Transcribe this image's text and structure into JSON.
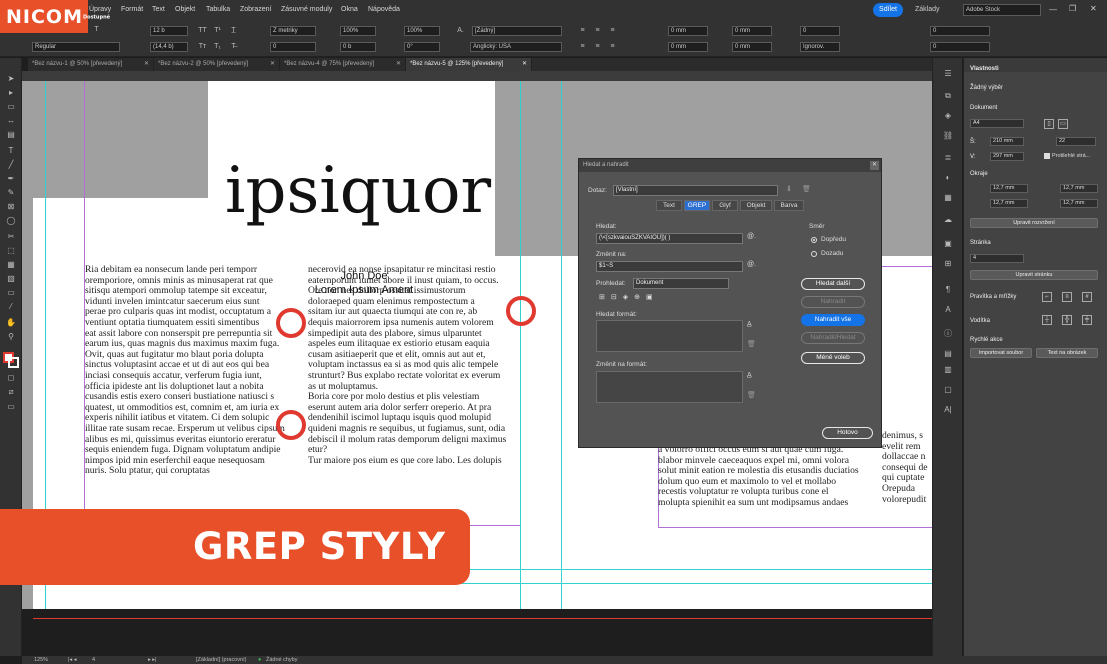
{
  "branding": {
    "logo": "NICOM",
    "logo_sub": "Dostupné",
    "badge": "GREP STYLY"
  },
  "menu": [
    "Úpravy",
    "Formát",
    "Text",
    "Objekt",
    "Tabulka",
    "Zobrazení",
    "Zásuvné moduly",
    "Okna",
    "Nápověda"
  ],
  "topbar": {
    "share": "Sdílet",
    "workspace": "Základy",
    "search_placeholder": "Adobe Stock"
  },
  "control": {
    "font_size": "12 b",
    "leading": "(14,4 b)",
    "font_style": "Regular",
    "tracking": "Z metriky",
    "kerning": "0",
    "hscale": "100%",
    "vscale": "100%",
    "baseline": "0 b",
    "skew": "0°",
    "char_style": "[Žádný]",
    "language": "Anglický: USA",
    "indent_left": "0 mm",
    "indent_right": "0 mm",
    "space_before": "0 mm",
    "space_after": "0 mm",
    "drop": "0",
    "hyphen": "Ignorov.",
    "cols": "0",
    "gutter": "0"
  },
  "tabs": [
    {
      "label": "*Bez názvu-1 @ 50% [převedený]",
      "close": "✕"
    },
    {
      "label": "*Bez názvu-2 @ 50% [převedený]",
      "close": "✕"
    },
    {
      "label": "*Bez názvu-4 @ 75% [převedený]",
      "close": "✕"
    },
    {
      "label": "*Bez názvu-5 @ 125% [převedený]",
      "close": "✕"
    }
  ],
  "document": {
    "big_word": "ipsiquor",
    "author": "John Doe",
    "subtitle": "Lorem Ipsum Ament",
    "page_number": "4",
    "col1": [
      "Ria debitam ea nonsecum lande peri temporr",
      "oremporiore, omnis minis as minusaperat rat que",
      "sitisqu atempori ommolup tatempe sit exceatur,",
      "vidunti invelen imintcatur saecerum eius sunt",
      "perae pro culparis quas int modist, occuptatum a",
      "ventiunt optatia tiumquatem essiti simentibus",
      "eat assit labore con nonserspit pre perrepuntia sit",
      "earum ius, quas magnis dus maximus maxim fuga.",
      "Ovit, quas aut fugitatur mo blaut poria dolupta",
      "sinctus voluptasint accae et ut di aut eos qui bea",
      "inciasi consequis accatur, verferum fugia iunt,",
      "officia ipideste ant lis doluptionet laut a nobita",
      "cusandis estis exero conseri bustiatione natiusci s",
      "quatest, ut ommoditios est, comnim et, am iuria ex",
      "experis nihilit iatibus et vitatem. Ci dem solupic",
      "illitae rate susam recae. Ersperum ut velibus cipsum",
      "alibus es mi, quissimus everitas eiuntorio ereratur",
      "sequis eniendem fuga. Dignam voluptatum andipie",
      "nimpos ipid min eserferchil eaque nesequosam",
      "nuris. Solu ptatur, qui coruptatas"
    ],
    "col2": [
      "necerovid ea nonse ipsapitatur re mincitasi restio",
      "eaternporunt iumet abore il inust quiam, to occus.",
      "Ore non nes dollorp ossitat issimustorum",
      "doloraeped quam elenimus rempostectum a",
      "ssitam iur aut quaecta tiumqui ate con re, ab",
      "dequis maiorrorem ipsa numenis autem volorem",
      "simpedipit auta des plabore, simus ulparuntet",
      "aspeles eum ilitaquae ex estiorio etusam eaquia",
      "cusam asitiaeperit que et elit, omnis aut aut et,",
      "voluptam inctassus ea si as mod quis alic tempele",
      "strunturt? Bus explabo rectate voloritat ex everum",
      "as ut moluptamus.",
      "Boria core por molo destius et plis velestiam",
      "eserunt autem aria dolor serferr oreperio. At pra",
      "dendenihil iscimol luptaqu isquis quod molupid",
      "quideni magnis re sequibus, ut fugiamus, sunt, odia",
      "debiscil il molum ratas demporum deligni maximus",
      "etur?",
      "Tur maiore pos eium es que core labo. Les dolupis"
    ],
    "col3": [
      "a volorro offici occus eum si aut quae cum fuga.",
      "blabor minvele caeceaquos expel mi, omni volora",
      "solut minit eation re molestia dis etusandis duciatios",
      "dolum quo eum et maximolo to vel et mollabo",
      "recestis voluptatur re volupta turibus cone el",
      "molupta spienihit ea sum unt modipsamus andaes"
    ],
    "col4": [
      "denimus, s",
      "evelit rem",
      "dollaccae n",
      "consequi de",
      "qui cuptate",
      "Orepuda",
      "volorepudit"
    ]
  },
  "dialog": {
    "title": "Hledat a nahradit",
    "query_label": "Dotaz:",
    "query_value": "[Vlastní]",
    "tabs": [
      "Text",
      "GREP",
      "Glyf",
      "Objekt",
      "Barva"
    ],
    "find_label": "Hledat:",
    "find_value": "(\\<[szkvaiouSZKVAIOU])( )",
    "change_label": "Změnit na:",
    "change_value": "$1~S",
    "search_label": "Prohledat:",
    "search_value": "Dokument",
    "find_format": "Hledat formát:",
    "change_format": "Změnit na formát:",
    "direction_label": "Směr",
    "forward": "Dopředu",
    "backward": "Dozadu",
    "btn_find_next": "Hledat další",
    "btn_replace": "Nahradit",
    "btn_replace_all": "Nahradit vše",
    "btn_replace_find": "Nahradit/Hledat",
    "btn_fewer": "Méně voleb",
    "btn_done": "Hotovo"
  },
  "properties": {
    "tab": "Vlastnosti",
    "no_selection": "Žádný výběr",
    "document_label": "Dokument",
    "page_size": "A4",
    "width_label": "Š:",
    "width": "210 mm",
    "height_label": "V:",
    "height": "297 mm",
    "pages": "22",
    "facing": "Protilehlé strá...",
    "margins_label": "Okraje",
    "margin_top": "12,7 mm",
    "margin_bottom": "12,7 mm",
    "margin_left": "12,7 mm",
    "margin_right": "12,7 mm",
    "btn_adjust_layout": "Upravit rozvržení",
    "page_label": "Stránka",
    "page_value": "4",
    "btn_edit_page": "Upravit stránku",
    "rulers_label": "Pravítka a mřížky",
    "guides_label": "Vodítka",
    "quick_actions": "Rychlé akce",
    "btn_import": "Importovat soubor",
    "btn_text_image": "Text na obrázek"
  },
  "status": {
    "zoom": "125%",
    "page": "4",
    "style": "[Základní] (pracovní)",
    "errors": "Žádné chyby"
  },
  "colors": {
    "accent": "#e8502a",
    "circle": "#e03a30",
    "blue": "#1473e6"
  }
}
